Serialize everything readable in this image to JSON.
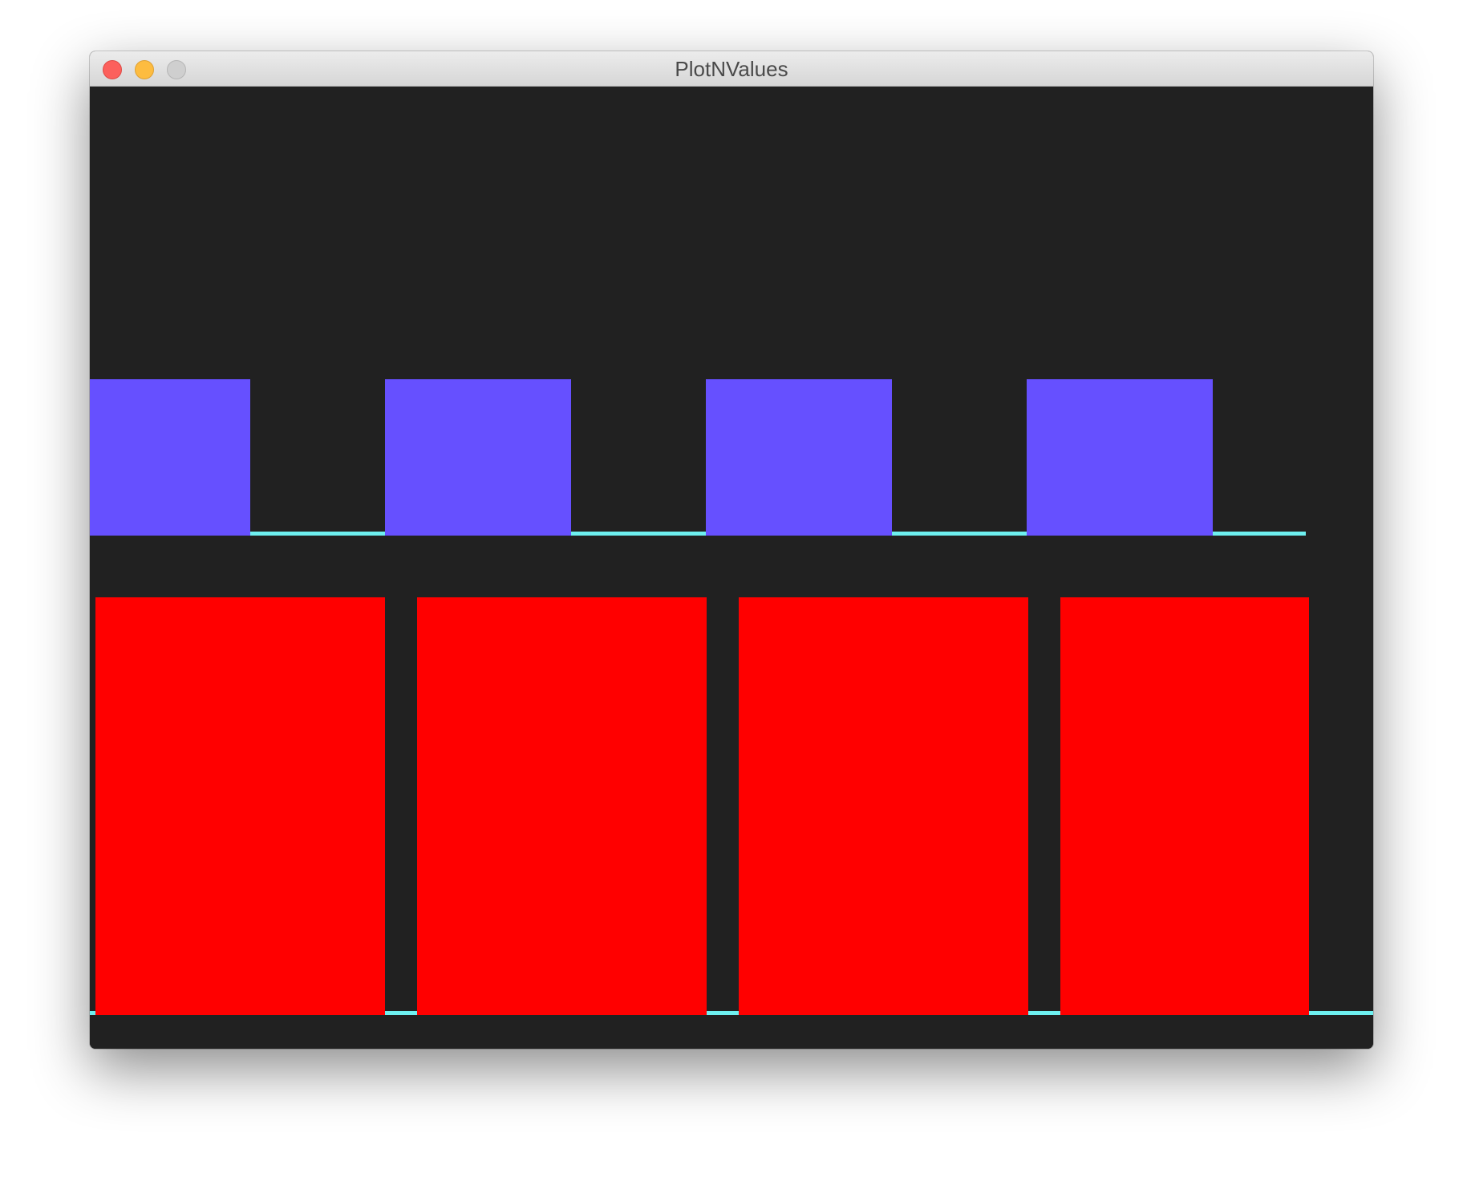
{
  "window": {
    "title": "PlotNValues",
    "background_color": "#212121",
    "controls": [
      "close-button",
      "minimize-button",
      "zoom-button"
    ]
  },
  "colors": {
    "top_series": "#6650ff",
    "bottom_series": "#ff0000",
    "baseline": "#6ef0f0"
  },
  "chart_data": [
    {
      "type": "bar",
      "series": [
        {
          "values": [
            1,
            0,
            1,
            0,
            1,
            0,
            1,
            0
          ],
          "segment_lengths": [
            200,
            168,
            232,
            168,
            232,
            168,
            232,
            116
          ]
        }
      ],
      "ylim": [
        0,
        1
      ]
    },
    {
      "type": "bar",
      "series": [
        {
          "values": [
            0,
            1,
            0,
            1,
            0,
            1,
            0,
            1,
            0
          ],
          "segment_lengths": [
            7,
            361,
            40,
            361,
            40,
            361,
            40,
            310,
            80
          ]
        }
      ],
      "ylim": [
        0,
        1
      ]
    }
  ]
}
